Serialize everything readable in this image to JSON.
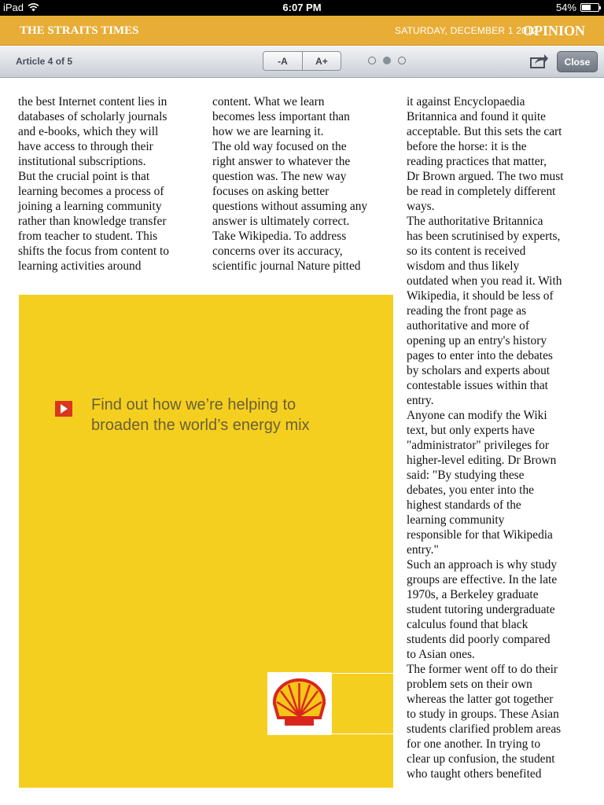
{
  "status_bar": {
    "device": "iPad",
    "time": "6:07 PM",
    "battery_percent": "54%",
    "battery_level": 0.54,
    "wifi_icon": "wifi-icon"
  },
  "masthead": {
    "publication": "THE STRAITS TIMES",
    "date": "SATURDAY, DECEMBER 1 2012",
    "section": "OPINION"
  },
  "toolbar": {
    "article_counter": "Article 4 of 5",
    "font_decrease_label": "-A",
    "font_increase_label": "A+",
    "page_dots": {
      "count": 3,
      "active_index": 1
    },
    "share_icon": "share-icon",
    "close_label": "Close"
  },
  "article": {
    "column1": "the best Internet content lies in\ndatabases of scholarly journals\nand e-books, which they will\nhave access to through their\ninstitutional subscriptions.\n But the crucial point is that\nlearning becomes a process of\njoining a learning community\nrather than knowledge transfer\nfrom teacher to student. This\nshifts the focus from content to\nlearning activities around",
    "column2": "content. What we learn\nbecomes less important than\nhow we are learning it.\n The old way focused on the\nright answer to whatever the\nquestion was. The new way\nfocuses on asking better\nquestions without assuming any\nanswer is ultimately correct.\n Take Wikipedia. To address\nconcerns over its accuracy,\nscientific journal Nature pitted",
    "column3": "it against Encyclopaedia\nBritannica and found it quite\nacceptable. But this sets the cart\nbefore the horse: it is the\nreading practices that matter,\nDr Brown argued. The two must\nbe read in completely different\nways.\n The authoritative Britannica\nhas been scrutinised by experts,\nso its content is received\nwisdom and thus likely\noutdated when you read it. With\nWikipedia, it should be less of\nreading the front page as\nauthoritative and more of\nopening up an entry's history\npages to enter into the debates\nby scholars and experts about\ncontestable issues within that\nentry.\n Anyone can modify the Wiki\ntext, but only experts have\n\"administrator\" privileges for\nhigher-level editing. Dr Brown\nsaid: \"By studying these\ndebates, you enter into the\nhighest standards of the\nlearning community\nresponsible for that Wikipedia\nentry.\"\n Such an approach is why study\ngroups are effective. In the late\n1970s, a Berkeley graduate\nstudent tutoring undergraduate\ncalculus found that black\nstudents did poorly compared\nto Asian ones.\n The former went off to do their\nproblem sets on their own\nwhereas the latter got together\nto study in groups. These Asian\nstudents clarified problem areas\nfor one another. In trying to\nclear up confusion, the student\nwho taught others benefited"
  },
  "advertisement": {
    "headline": "Find out how we’re helping to\nbroaden the world’s energy mix",
    "background_color": "#f5cf1f",
    "logo_icon": "shell-logo-icon",
    "play_icon": "play-arrow-icon"
  }
}
